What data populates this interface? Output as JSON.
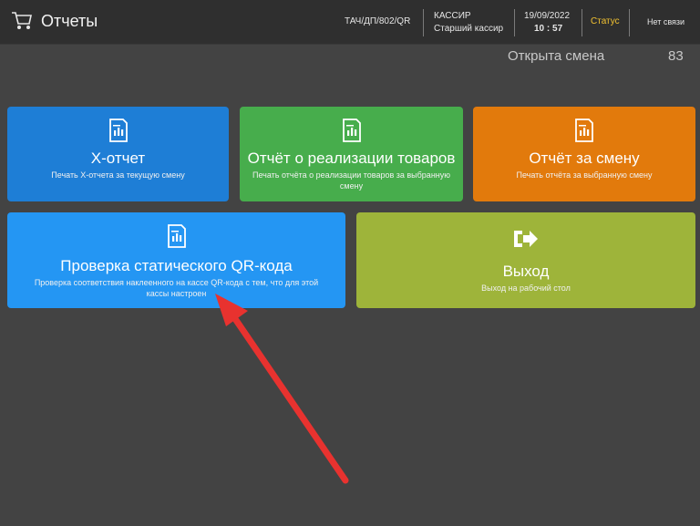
{
  "header": {
    "title": "Отчеты",
    "terminal_code": "ТАЧ/ДП/802/QR",
    "role_label": "КАССИР",
    "role_name": "Старший кассир",
    "date": "19/09/2022",
    "time": "10 : 57",
    "status_label": "Статус",
    "connection": "Нет связи"
  },
  "shift": {
    "label": "Открыта смена",
    "number": "83"
  },
  "tiles": [
    {
      "title": "X-отчет",
      "subtitle": "Печать X-отчета за текущую смену",
      "color": "#1e7ed6",
      "icon": "report-document-icon"
    },
    {
      "title": "Отчёт о реализации товаров",
      "subtitle": "Печать отчёта о реализации товаров за выбранную смену",
      "color": "#47ad4c",
      "icon": "report-document-icon"
    },
    {
      "title": "Отчёт за смену",
      "subtitle": "Печать отчёта за выбранную смену",
      "color": "#e27a0c",
      "icon": "report-document-icon"
    },
    {
      "title": "Проверка статического QR-кода",
      "subtitle": "Проверка соответствия наклеенного на кассе QR-кода с тем, что для этой кассы настроен",
      "color": "#2496f3",
      "icon": "report-document-icon"
    },
    {
      "title": "Выход",
      "subtitle": "Выход на рабочий стол",
      "color": "#9eb43a",
      "icon": "sign-out-icon"
    }
  ],
  "colors": {
    "background": "#434343",
    "header": "#2f2f2f",
    "status": "#f2c230",
    "annotation_arrow": "#e8322f"
  }
}
